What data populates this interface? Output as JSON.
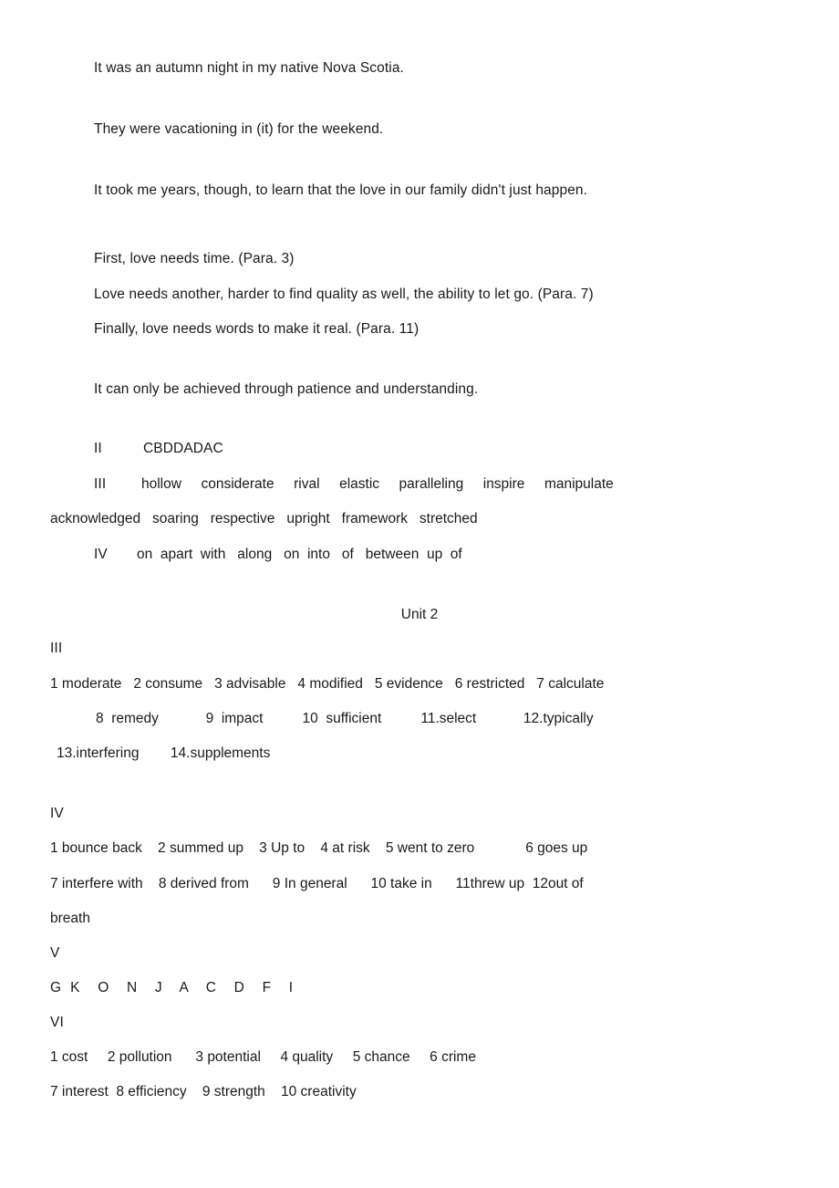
{
  "document": {
    "unit_heading": "Unit 2",
    "paragraphs": [
      "It was an autumn night in my native Nova Scotia.",
      "They were vacationing in (it) for the weekend.",
      "It took me years, though, to learn that the love in our family didn't just happen.",
      "First, love needs time. (Para. 3)",
      "Love needs another, harder to find quality as well, the ability to let go. (Para. 7)",
      "Finally, love needs words to make it real. (Para. 11)",
      "It can only be achieved through patience and understanding."
    ],
    "unit1": {
      "section_2": {
        "label": "II",
        "answers": "CBDDADAC"
      },
      "section_3": {
        "label": "III",
        "line1": "hollow     considerate     rival     elastic     paralleling     inspire     manipulate",
        "line2": "acknowledged   soaring   respective   upright   framework   stretched"
      },
      "section_4": {
        "label": "IV",
        "answers": "on  apart  with   along   on  into   of   between  up  of"
      }
    },
    "unit2": {
      "section_3": {
        "label": "III",
        "line1": "1 moderate   2 consume   3 advisable   4 modified   5 evidence   6 restricted   7 calculate",
        "line2": "8  remedy            9  impact          10  sufficient          11.select            12.typically",
        "line3": "13.interfering        14.supplements"
      },
      "section_4": {
        "label": "IV",
        "line1": "1 bounce back    2 summed up    3 Up to    4 at risk    5 went to zero             6 goes up",
        "line2": "7 interfere with    8 derived from      9 In general      10 take in      11threw up  12out of",
        "line3": "breath"
      },
      "section_5": {
        "label": "V",
        "answers": "G  K    O    N    J    A    C    D    F    I"
      },
      "section_6": {
        "label": "VI",
        "line1": "1 cost     2 pollution      3 potential     4 quality     5 chance     6 crime",
        "line2": "7 interest  8 efficiency    9 strength    10 creativity"
      }
    }
  }
}
